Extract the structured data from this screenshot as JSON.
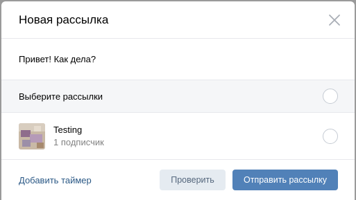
{
  "modal": {
    "title": "Новая рассылка"
  },
  "message": {
    "text": "Привет! Как дела?"
  },
  "select_all": {
    "label": "Выберите рассылки"
  },
  "mailings": [
    {
      "name": "Testing",
      "subscribers": "1 подписчик",
      "avatar_icon": "photo-thumbnail-icon"
    }
  ],
  "footer": {
    "timer_link": "Добавить таймер",
    "check_button": "Проверить",
    "send_button": "Отправить рассылку"
  },
  "colors": {
    "primary": "#5181b8",
    "secondary": "#e5ebf1",
    "link": "#2a5885"
  }
}
